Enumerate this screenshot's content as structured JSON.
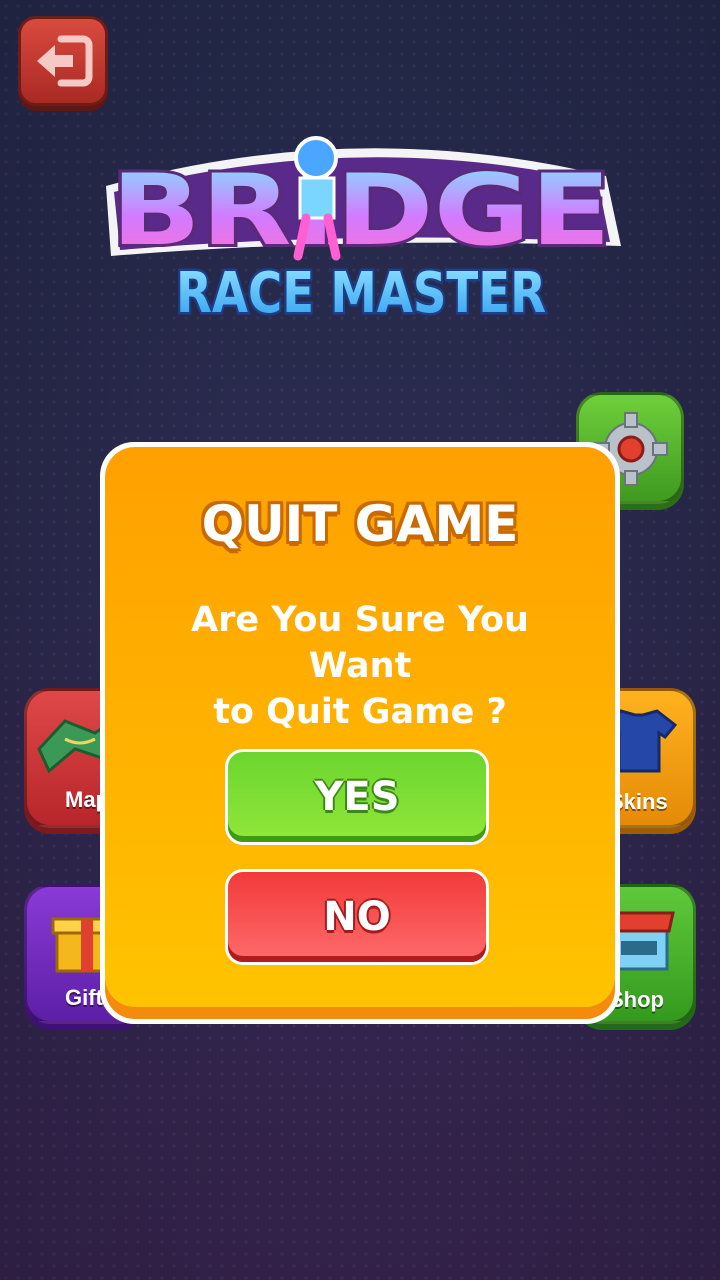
{
  "logo": {
    "title": "BRIDGE",
    "subtitle": "RACE MASTER"
  },
  "menu": {
    "map_label": "Map",
    "skins_label": "Skins",
    "gift_label": "Gift",
    "shop_label": "Shop"
  },
  "dialog": {
    "title": "QUIT GAME",
    "message_line1": "Are You Sure You Want",
    "message_line2": "to Quit Game ?",
    "yes_label": "YES",
    "no_label": "NO"
  },
  "colors": {
    "dialog_bg": "#ffb300",
    "yes_green": "#7cdc33",
    "no_red": "#f24545",
    "back_red": "#c23a32"
  },
  "icons": {
    "back": "exit-arrow-icon",
    "settings": "gear-icon",
    "map": "map-icon",
    "skins": "tshirt-icon",
    "gift": "gift-icon",
    "shop": "shop-icon"
  }
}
